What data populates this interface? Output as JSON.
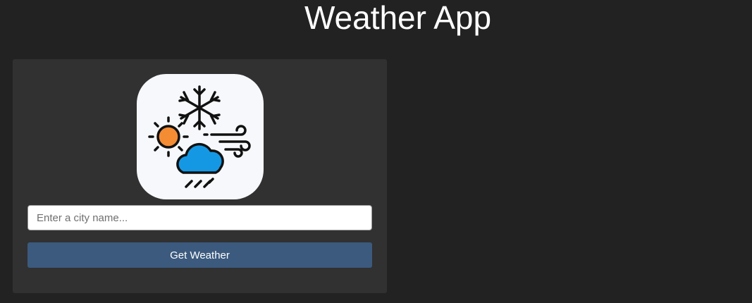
{
  "header": {
    "title": "Weather App"
  },
  "card": {
    "logo_icon": "weather-app-logo-icon",
    "search": {
      "placeholder": "Enter a city name...",
      "value": ""
    },
    "submit_label": "Get Weather"
  },
  "colors": {
    "page_background": "#222222",
    "card_background": "#313131",
    "button_background": "#3b5a7e",
    "logo_background": "#f6f8fb",
    "sun": "#f48c34",
    "cloud": "#1598e4"
  }
}
